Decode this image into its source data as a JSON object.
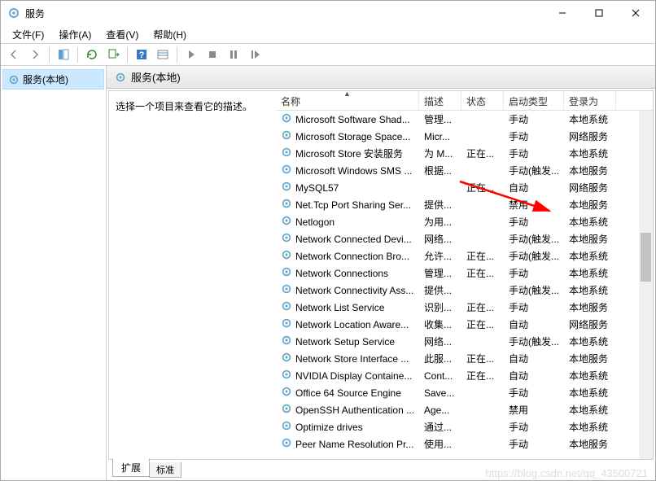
{
  "window": {
    "title": "服务",
    "minimize": "—",
    "maximize": "□",
    "close": "✕"
  },
  "menubar": {
    "file": "文件(F)",
    "action": "操作(A)",
    "view": "查看(V)",
    "help": "帮助(H)"
  },
  "tree": {
    "root": "服务(本地)"
  },
  "paneheader": "服务(本地)",
  "leftdesc": "选择一个项目来查看它的描述。",
  "columns": {
    "name": "名称",
    "desc": "描述",
    "status": "状态",
    "startup": "启动类型",
    "logon": "登录为"
  },
  "tabs": {
    "ext": "扩展",
    "std": "标准"
  },
  "services": [
    {
      "name": "Microsoft Software Shad...",
      "desc": "管理...",
      "status": "",
      "startup": "手动",
      "logon": "本地系统"
    },
    {
      "name": "Microsoft Storage Space...",
      "desc": "Micr...",
      "status": "",
      "startup": "手动",
      "logon": "网络服务"
    },
    {
      "name": "Microsoft Store 安装服务",
      "desc": "为 M...",
      "status": "正在...",
      "startup": "手动",
      "logon": "本地系统"
    },
    {
      "name": "Microsoft Windows SMS ...",
      "desc": "根据...",
      "status": "",
      "startup": "手动(触发...",
      "logon": "本地服务"
    },
    {
      "name": "MySQL57",
      "desc": "",
      "status": "正在...",
      "startup": "自动",
      "logon": "网络服务"
    },
    {
      "name": "Net.Tcp Port Sharing Ser...",
      "desc": "提供...",
      "status": "",
      "startup": "禁用",
      "logon": "本地服务"
    },
    {
      "name": "Netlogon",
      "desc": "为用...",
      "status": "",
      "startup": "手动",
      "logon": "本地系统"
    },
    {
      "name": "Network Connected Devi...",
      "desc": "网络...",
      "status": "",
      "startup": "手动(触发...",
      "logon": "本地服务"
    },
    {
      "name": "Network Connection Bro...",
      "desc": "允许...",
      "status": "正在...",
      "startup": "手动(触发...",
      "logon": "本地系统"
    },
    {
      "name": "Network Connections",
      "desc": "管理...",
      "status": "正在...",
      "startup": "手动",
      "logon": "本地系统"
    },
    {
      "name": "Network Connectivity Ass...",
      "desc": "提供...",
      "status": "",
      "startup": "手动(触发...",
      "logon": "本地系统"
    },
    {
      "name": "Network List Service",
      "desc": "识别...",
      "status": "正在...",
      "startup": "手动",
      "logon": "本地服务"
    },
    {
      "name": "Network Location Aware...",
      "desc": "收集...",
      "status": "正在...",
      "startup": "自动",
      "logon": "网络服务"
    },
    {
      "name": "Network Setup Service",
      "desc": "网络...",
      "status": "",
      "startup": "手动(触发...",
      "logon": "本地系统"
    },
    {
      "name": "Network Store Interface ...",
      "desc": "此服...",
      "status": "正在...",
      "startup": "自动",
      "logon": "本地服务"
    },
    {
      "name": "NVIDIA Display Containe...",
      "desc": "Cont...",
      "status": "正在...",
      "startup": "自动",
      "logon": "本地系统"
    },
    {
      "name": "Office 64 Source Engine",
      "desc": "Save...",
      "status": "",
      "startup": "手动",
      "logon": "本地系统"
    },
    {
      "name": "OpenSSH Authentication ...",
      "desc": "Age...",
      "status": "",
      "startup": "禁用",
      "logon": "本地系统"
    },
    {
      "name": "Optimize drives",
      "desc": "通过...",
      "status": "",
      "startup": "手动",
      "logon": "本地系统"
    },
    {
      "name": "Peer Name Resolution Pr...",
      "desc": "使用...",
      "status": "",
      "startup": "手动",
      "logon": "本地服务"
    }
  ],
  "watermark": "https://blog.csdn.net/qq_43500721"
}
